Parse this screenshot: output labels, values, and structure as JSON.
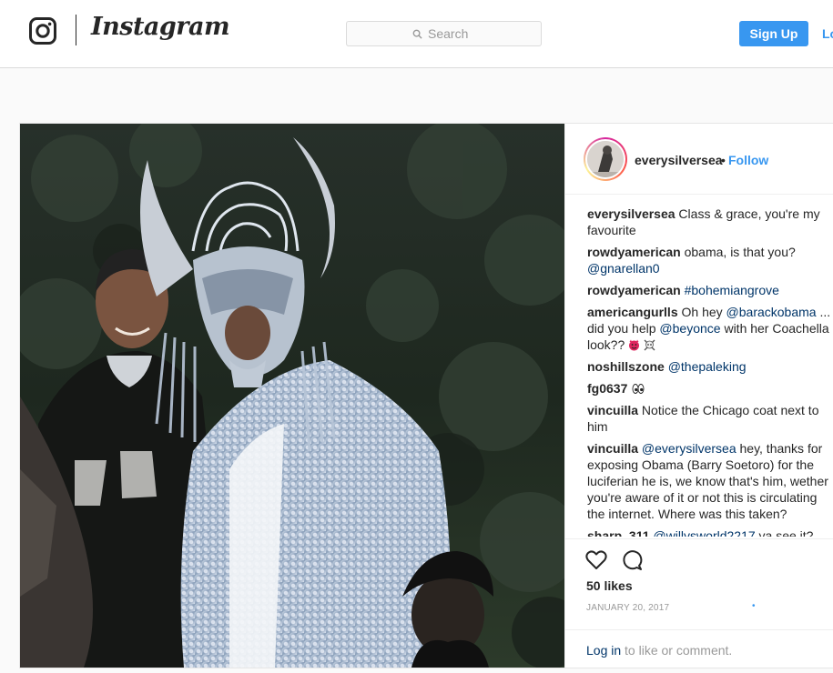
{
  "header": {
    "logo_icon": "instagram-glyph-icon",
    "wordmark": "Instagram",
    "search_placeholder": "Search",
    "signup_label": "Sign Up",
    "login_label": "Log In"
  },
  "post": {
    "username": "everysilversea",
    "separator": "•",
    "follow_label": "Follow",
    "comments": [
      {
        "user": "everysilversea",
        "parts": [
          {
            "text": " Class & grace, you're my favourite"
          }
        ]
      },
      {
        "user": "rowdyamerican",
        "parts": [
          {
            "text": " obama, is that you? "
          },
          {
            "link": "@gnarellan0"
          }
        ]
      },
      {
        "user": "rowdyamerican",
        "parts": [
          {
            "text": " "
          },
          {
            "link": "#bohemiangrove"
          }
        ]
      },
      {
        "user": "americangurlls",
        "parts": [
          {
            "text": " Oh hey "
          },
          {
            "link": "@barackobama"
          },
          {
            "text": " ... did you help "
          },
          {
            "link": "@beyonce"
          },
          {
            "text": " with her Coachella look?? "
          },
          {
            "emoji": "devil-face-icon"
          },
          {
            "text": " "
          },
          {
            "emoji": "skull-crossbones-icon"
          }
        ]
      },
      {
        "user": "noshillszone",
        "parts": [
          {
            "text": " "
          },
          {
            "link": "@thepaleking"
          }
        ]
      },
      {
        "user": "fg0637",
        "parts": [
          {
            "text": " "
          },
          {
            "emoji": "eyes-icon"
          }
        ]
      },
      {
        "user": "vincuilla",
        "parts": [
          {
            "text": " Notice the Chicago coat next to him"
          }
        ]
      },
      {
        "user": "vincuilla",
        "parts": [
          {
            "text": " "
          },
          {
            "link": "@everysilversea"
          },
          {
            "text": " hey, thanks for exposing Obama (Barry Soetoro) for the luciferian he is, we know that's him, wether you're aware of it or not this is circulating the internet. Where was this taken?"
          }
        ]
      },
      {
        "user": "sharp_311",
        "parts": [
          {
            "text": " "
          },
          {
            "link": "@willysworld2217"
          },
          {
            "text": " ya see it?"
          }
        ]
      }
    ],
    "likes": "50 likes",
    "date": "JANUARY 20, 2017",
    "date_dot": "•",
    "login_link": "Log in",
    "login_suffix": " to like or comment.",
    "colors": {
      "accent": "#3897f0",
      "link": "#003569",
      "text": "#262626",
      "muted": "#999999"
    }
  }
}
